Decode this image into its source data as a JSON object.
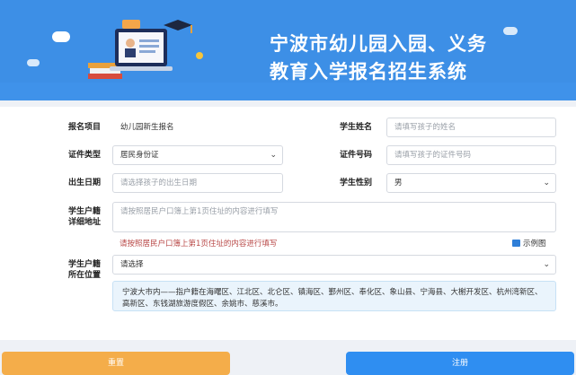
{
  "header": {
    "title_line1": "宁波市幼儿园入园、义务",
    "title_line2": "教育入学报名招生系统"
  },
  "form": {
    "project": {
      "label": "报名项目",
      "value": "幼儿园新生报名"
    },
    "student_name": {
      "label": "学生姓名",
      "placeholder": "请填写孩子的姓名"
    },
    "id_type": {
      "label": "证件类型",
      "value": "居民身份证"
    },
    "id_number": {
      "label": "证件号码",
      "placeholder": "请填写孩子的证件号码"
    },
    "birth_date": {
      "label": "出生日期",
      "placeholder": "请选择孩子的出生日期"
    },
    "gender": {
      "label": "学生性别",
      "value": "男"
    },
    "address": {
      "label_line1": "学生户籍",
      "label_line2": "详细地址",
      "placeholder": "请按照居民户口簿上第1页住址的内容进行填写",
      "warning": "请按照居民户口簿上第1页住址的内容进行填写",
      "example_label": "示例图"
    },
    "location": {
      "label_line1": "学生户籍",
      "label_line2": "所在位置",
      "value": "请选择",
      "info": "宁波大市内——指户籍在海曙区、江北区、北仑区、镇海区、鄞州区、奉化区、象山县、宁海县、大榭开发区、杭州湾新区、高新区、东钱湖旅游度假区、余姚市、慈溪市。"
    }
  },
  "buttons": {
    "reset": "重置",
    "submit": "注册"
  },
  "colors": {
    "banner": "#3d8fe6",
    "reset": "#f4ad4a",
    "submit": "#2f8ef1",
    "warning": "#b94a48"
  }
}
